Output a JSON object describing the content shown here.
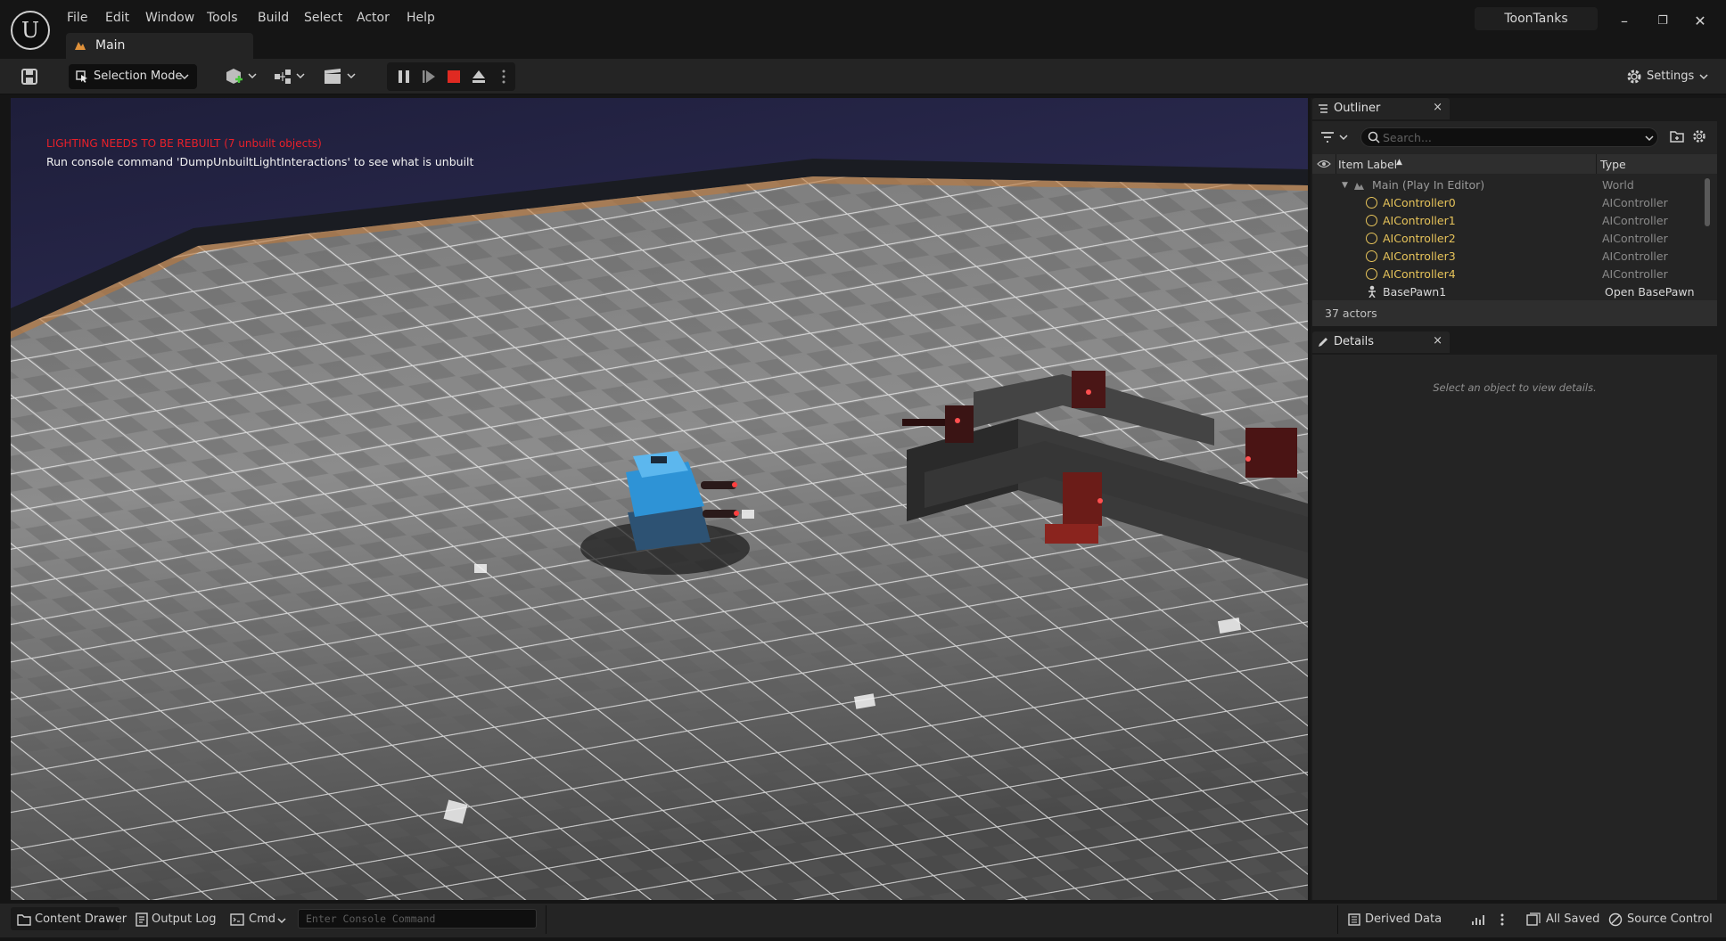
{
  "menu": [
    "File",
    "Edit",
    "Window",
    "Tools",
    "Build",
    "Select",
    "Actor",
    "Help"
  ],
  "document_tab": {
    "label": "Main"
  },
  "project_name": "ToonTanks",
  "toolbar": {
    "selection_mode": "Selection Mode",
    "settings": "Settings"
  },
  "viewport": {
    "warning": "LIGHTING NEEDS TO BE REBUILT (7 unbuilt objects)",
    "hint": "Run console command 'DumpUnbuiltLightInteractions' to see what is unbuilt"
  },
  "outliner": {
    "tab_label": "Outliner",
    "search_placeholder": "Search...",
    "columns": {
      "label": "Item Label",
      "type": "Type"
    },
    "rows": [
      {
        "label": "Main (Play In Editor)",
        "type": "World"
      },
      {
        "label": "AIController0",
        "type": "AIController"
      },
      {
        "label": "AIController1",
        "type": "AIController"
      },
      {
        "label": "AIController2",
        "type": "AIController"
      },
      {
        "label": "AIController3",
        "type": "AIController"
      },
      {
        "label": "AIController4",
        "type": "AIController"
      },
      {
        "label": "BasePawn1",
        "type": "Open BasePawn"
      }
    ],
    "actors_count": "37 actors"
  },
  "details": {
    "tab_label": "Details",
    "empty_message": "Select an object to view details."
  },
  "statusbar": {
    "content_drawer": "Content Drawer",
    "output_log": "Output Log",
    "cmd": "Cmd",
    "console_placeholder": "Enter Console Command",
    "derived_data": "Derived Data",
    "all_saved": "All Saved",
    "source_control": "Source Control"
  },
  "colors": {
    "accent_gold": "#e6c35a",
    "warning_red": "#e8202a",
    "tank_blue": "#2e93d6",
    "turret_red": "#b8241f"
  }
}
